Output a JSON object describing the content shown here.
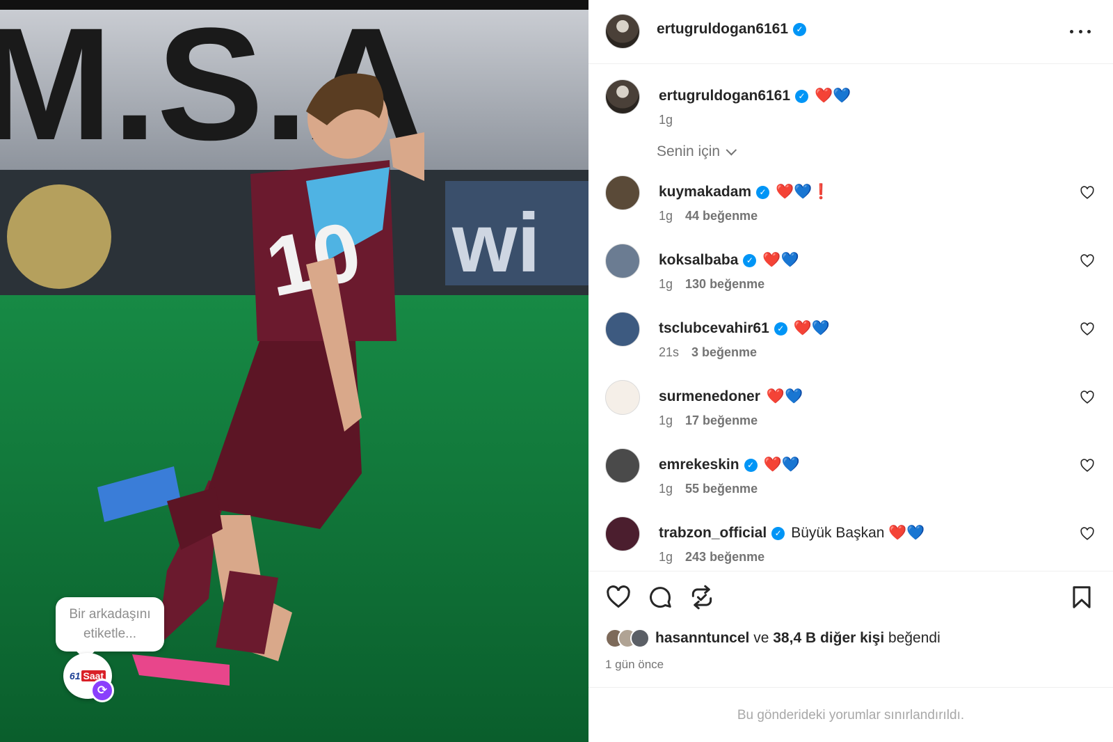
{
  "post": {
    "author": "ertugruldogan6161",
    "verified_badge": "verified-icon",
    "photo_tag_prompt": "Bir arkadaşını etiketle...",
    "photo_tag_brand_number": "61",
    "photo_tag_brand_word": "Saat"
  },
  "caption": {
    "user": "ertugruldogan6161",
    "text": "❤️💙",
    "time": "1g"
  },
  "sort": {
    "label": "Senin için"
  },
  "comments": [
    {
      "user": "kuymakadam",
      "verified": true,
      "text": "❤️💙❗",
      "time": "1g",
      "likes": "44 beğenme",
      "avatar_color": "#5a4a38"
    },
    {
      "user": "koksalbaba",
      "verified": true,
      "text": "❤️💙",
      "time": "1g",
      "likes": "130 beğenme",
      "avatar_color": "#6b7c92"
    },
    {
      "user": "tsclubcevahir61",
      "verified": true,
      "text": "❤️💙",
      "time": "21s",
      "likes": "3 beğenme",
      "avatar_color": "#3d5a80"
    },
    {
      "user": "surmenedoner",
      "verified": false,
      "text": "❤️💙",
      "time": "1g",
      "likes": "17 beğenme",
      "avatar_color": "#f5efe8"
    },
    {
      "user": "emrekeskin",
      "verified": true,
      "text": "❤️💙",
      "time": "1g",
      "likes": "55 beğenme",
      "avatar_color": "#4a4a4a"
    },
    {
      "user": "trabzon_official",
      "verified": true,
      "text": "Büyük Başkan ❤️💙",
      "time": "1g",
      "likes": "243 beğenme",
      "avatar_color": "#4b1e2e"
    }
  ],
  "likes": {
    "user": "hasanntuncel",
    "connector": "ve",
    "others": "38,4 B diğer kişi",
    "suffix": "beğendi"
  },
  "date": "1 gün önce",
  "restricted_notice": "Bu gönderideki yorumlar sınırlandırıldı.",
  "colors": {
    "accent": "#0095f6",
    "text": "#262626",
    "muted": "#737373",
    "tag_badge": "#8a3ffc"
  }
}
